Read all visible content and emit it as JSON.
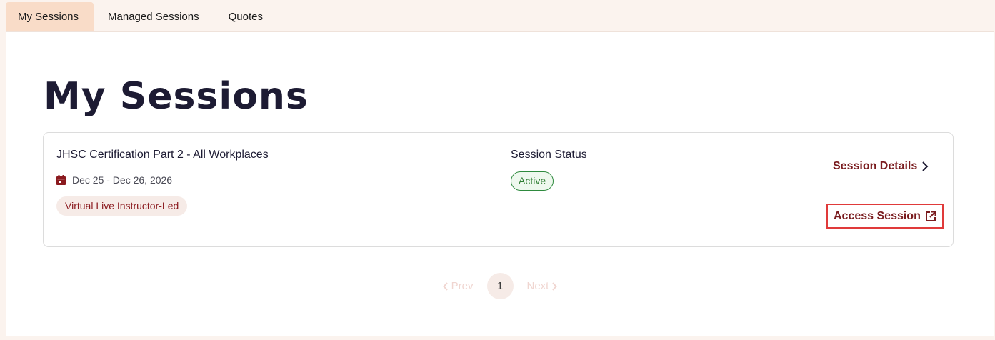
{
  "tabs": [
    {
      "label": "My Sessions",
      "active": true
    },
    {
      "label": "Managed Sessions",
      "active": false
    },
    {
      "label": "Quotes",
      "active": false
    }
  ],
  "page": {
    "title": "My Sessions"
  },
  "session": {
    "title": "JHSC Certification Part 2 - All Workplaces",
    "date_range": "Dec 25 - Dec 26, 2026",
    "delivery_tag": "Virtual Live Instructor-Led",
    "status_label": "Session Status",
    "status_value": "Active",
    "details_link": "Session Details",
    "access_link": "Access Session",
    "icons": {
      "date": "calendar-icon",
      "details": "chevron-right-icon",
      "access": "external-link-icon"
    }
  },
  "pagination": {
    "prev": "Prev",
    "current": "1",
    "next": "Next"
  },
  "colors": {
    "accent": "#7a1c1f",
    "active_tab": "#f9dcc8",
    "status_green": "#2e7d32",
    "highlight_box": "#e03a3a"
  }
}
